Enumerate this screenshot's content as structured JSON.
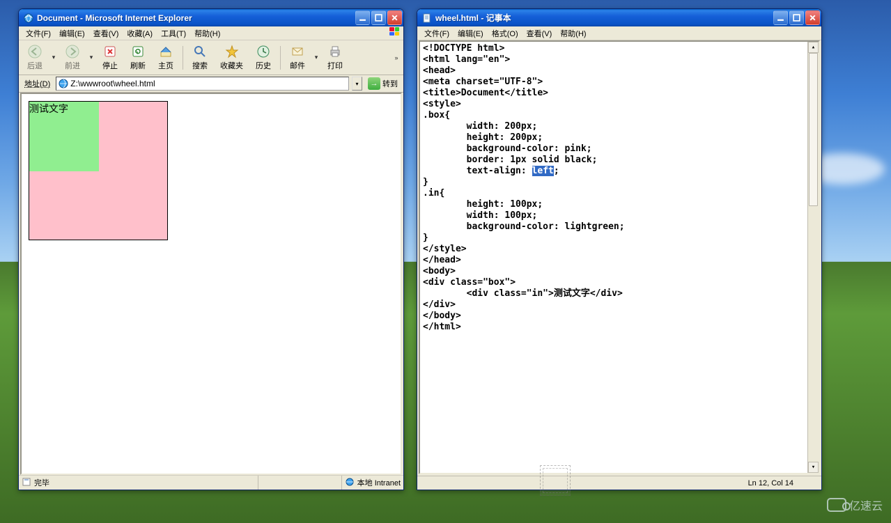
{
  "ie": {
    "title": "Document - Microsoft Internet Explorer",
    "menus": [
      "文件(F)",
      "编辑(E)",
      "查看(V)",
      "收藏(A)",
      "工具(T)",
      "帮助(H)"
    ],
    "toolbar": {
      "back": "后退",
      "forward": "前进",
      "stop": "停止",
      "refresh": "刷新",
      "home": "主页",
      "search": "搜索",
      "favorites": "收藏夹",
      "history": "历史",
      "mail": "邮件",
      "print": "打印"
    },
    "address_label": "地址(D)",
    "address_value": "Z:\\wwwroot\\wheel.html",
    "go_label": "转到",
    "demo_text": "测试文字",
    "status_done": "完毕",
    "status_zone": "本地 Intranet"
  },
  "notepad": {
    "title": "wheel.html - 记事本",
    "menus": [
      "文件(F)",
      "编辑(E)",
      "格式(O)",
      "查看(V)",
      "帮助(H)"
    ],
    "code_pre": "<!DOCTYPE html>\n<html lang=\"en\">\n<head>\n<meta charset=\"UTF-8\">\n<title>Document</title>\n<style>\n.box{\n        width: 200px;\n        height: 200px;\n        background-color: pink;\n        border: 1px solid black;\n        text-align: ",
    "code_sel": "left",
    "code_post": ";\n}\n.in{\n        height: 100px;\n        width: 100px;\n        background-color: lightgreen;\n}\n</style>\n</head>\n<body>\n<div class=\"box\">\n        <div class=\"in\">测试文字</div>\n</div>\n</body>\n</html>",
    "status": "Ln 12, Col 14"
  },
  "watermark": "亿速云"
}
